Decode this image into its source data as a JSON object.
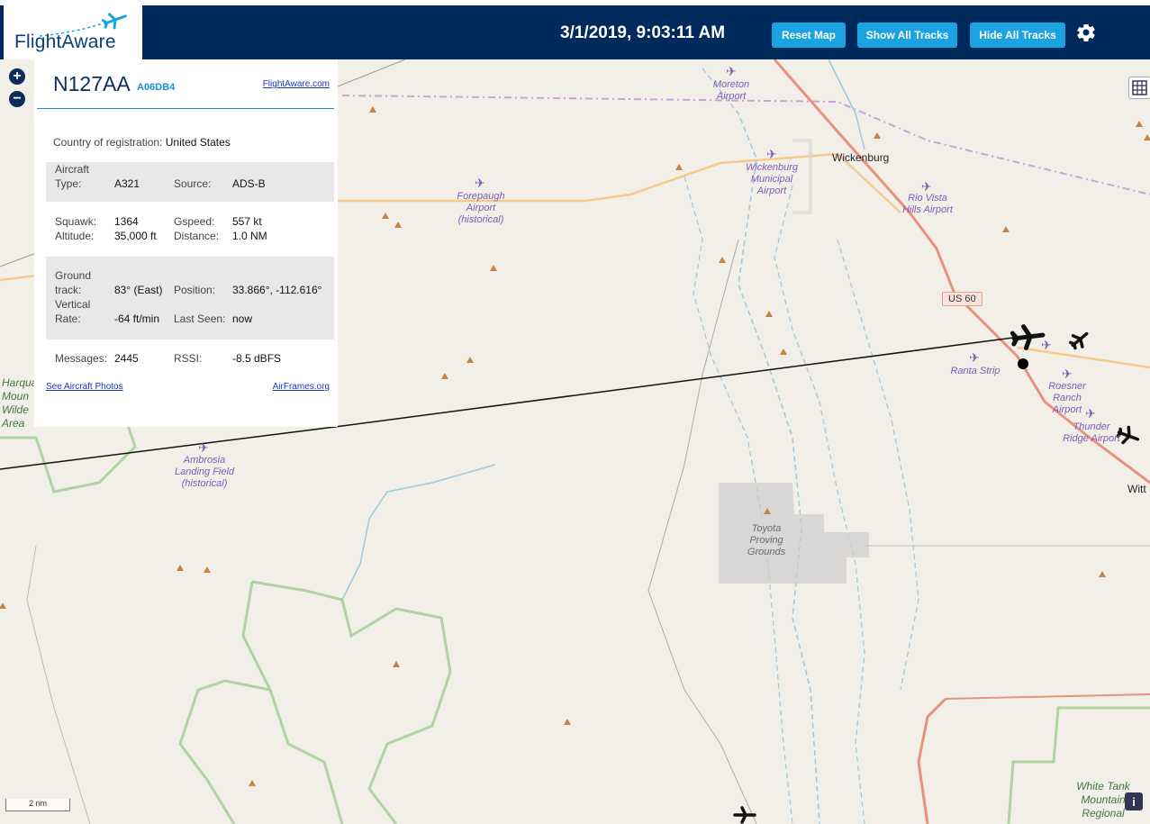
{
  "header": {
    "logo_text": "FlightAware",
    "datetime": "3/1/2019, 9:03:11 AM",
    "buttons": {
      "reset_map": "Reset Map",
      "show_all_tracks": "Show All Tracks",
      "hide_all_tracks": "Hide All Tracks"
    },
    "settings_icon": "gear-icon"
  },
  "map_controls": {
    "zoom_in": "+",
    "zoom_out": "−",
    "scale": "2 nm",
    "info": "i",
    "layers_icon": "grid-icon"
  },
  "map_labels": {
    "moreton": "Moreton Airport",
    "wickenburg_town": "Wickenburg",
    "wickenburg_airport": "Wickenburg Municipal Airport",
    "forepaugh": "Forepaugh Airport (historical)",
    "rio_vista": "Rio Vista Hills Airport",
    "us60": "US 60",
    "ranta": "Ranta Strip",
    "roesner": "Roesner Ranch Airport",
    "thunder": "Thunder Ridge Airport",
    "witt": "Witt",
    "ambrosia": "Ambrosia Landing Field (historical)",
    "toyota": "Toyota Proving Grounds",
    "harqua": "Harqua Moun Wilde Area",
    "white_tank": "White Tank Mountain Regional"
  },
  "aircraft_panel": {
    "registration": "N127AA",
    "hex": "A06DB4",
    "flightaware_link": "FlightAware.com",
    "country_label": "Country of registration:",
    "country_value": "United States",
    "fields": {
      "aircraft_type_label": "Aircraft Type:",
      "aircraft_type_value": "A321",
      "source_label": "Source:",
      "source_value": "ADS-B",
      "squawk_label": "Squawk:",
      "squawk_value": "1364",
      "gspeed_label": "Gspeed:",
      "gspeed_value": "557 kt",
      "altitude_label": "Altitude:",
      "altitude_value": "35,000 ft",
      "distance_label": "Distance:",
      "distance_value": "1.0 NM",
      "ground_track_label": "Ground track:",
      "ground_track_value": "83° (East)",
      "position_label": "Position:",
      "position_value": "33.866°, -112.616°",
      "vertical_rate_label": "Vertical Rate:",
      "vertical_rate_value": "-64 ft/min",
      "last_seen_label": "Last Seen:",
      "last_seen_value": "now",
      "messages_label": "Messages:",
      "messages_value": "2445",
      "rssi_label": "RSSI:",
      "rssi_value": "-8.5 dBFS"
    },
    "aircraft_photos_link": "See Aircraft Photos",
    "airframes_link": "AirFrames.org"
  },
  "colors": {
    "header_bg": "#002a5c",
    "button": "#1aa3e0",
    "airport_label": "#7b5cb8",
    "road_major": "#e8927c",
    "road_minor": "#f7c98a",
    "park_border": "#9fcc8f",
    "water": "#9cc9dd"
  }
}
